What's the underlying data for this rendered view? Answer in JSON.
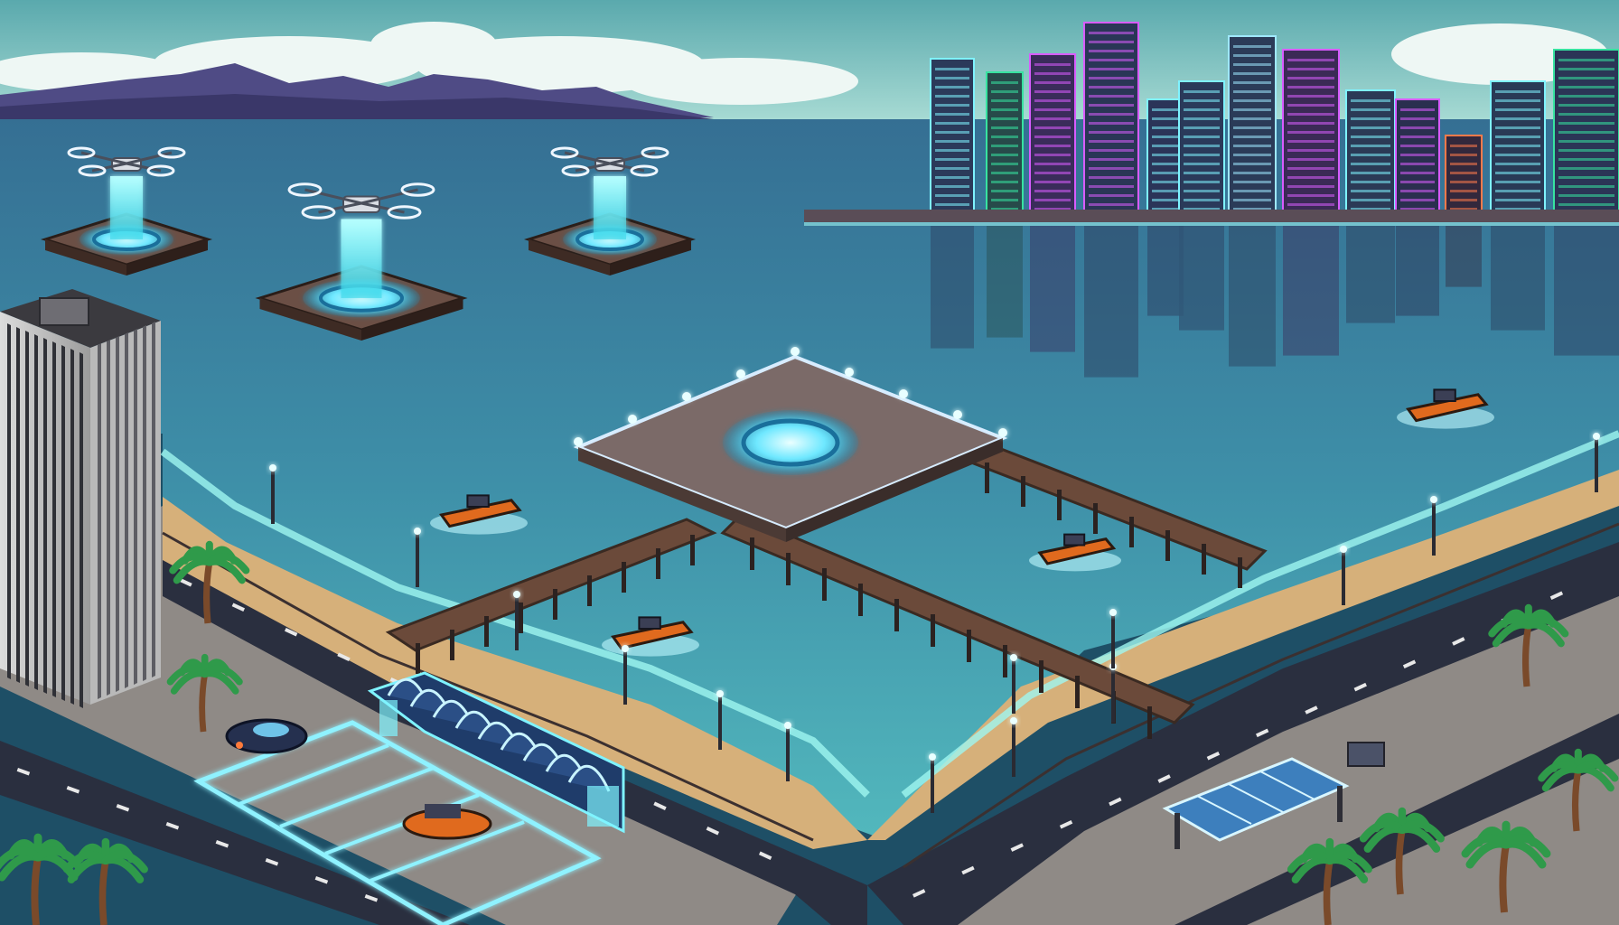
{
  "scene": {
    "palette": {
      "sky_top": "#5fb0b2",
      "sky_bottom": "#a9dcd6",
      "mountains": "#4e4a86",
      "water_far": "#3b86a3",
      "water_near": "#4aa9b8",
      "sand": "#d6b07a",
      "road": "#2a2f3f",
      "sidewalk": "#8f8a86",
      "pier_wood": "#6b4a3a",
      "glow": "#7ff3ff",
      "neon_pink": "#d85cff",
      "neon_green": "#37e3a0",
      "boat_orange": "#e06a1e"
    },
    "drones": [
      {
        "name": "drone-1"
      },
      {
        "name": "drone-2"
      },
      {
        "name": "drone-3"
      }
    ],
    "boats": [
      {
        "name": "boat-left"
      },
      {
        "name": "boat-center"
      },
      {
        "name": "boat-right"
      },
      {
        "name": "boat-far"
      }
    ],
    "parked_vehicles": [
      {
        "name": "parked-car"
      },
      {
        "name": "parked-boat-trailer"
      }
    ],
    "palm_trees": 9,
    "streetlights": 14
  }
}
